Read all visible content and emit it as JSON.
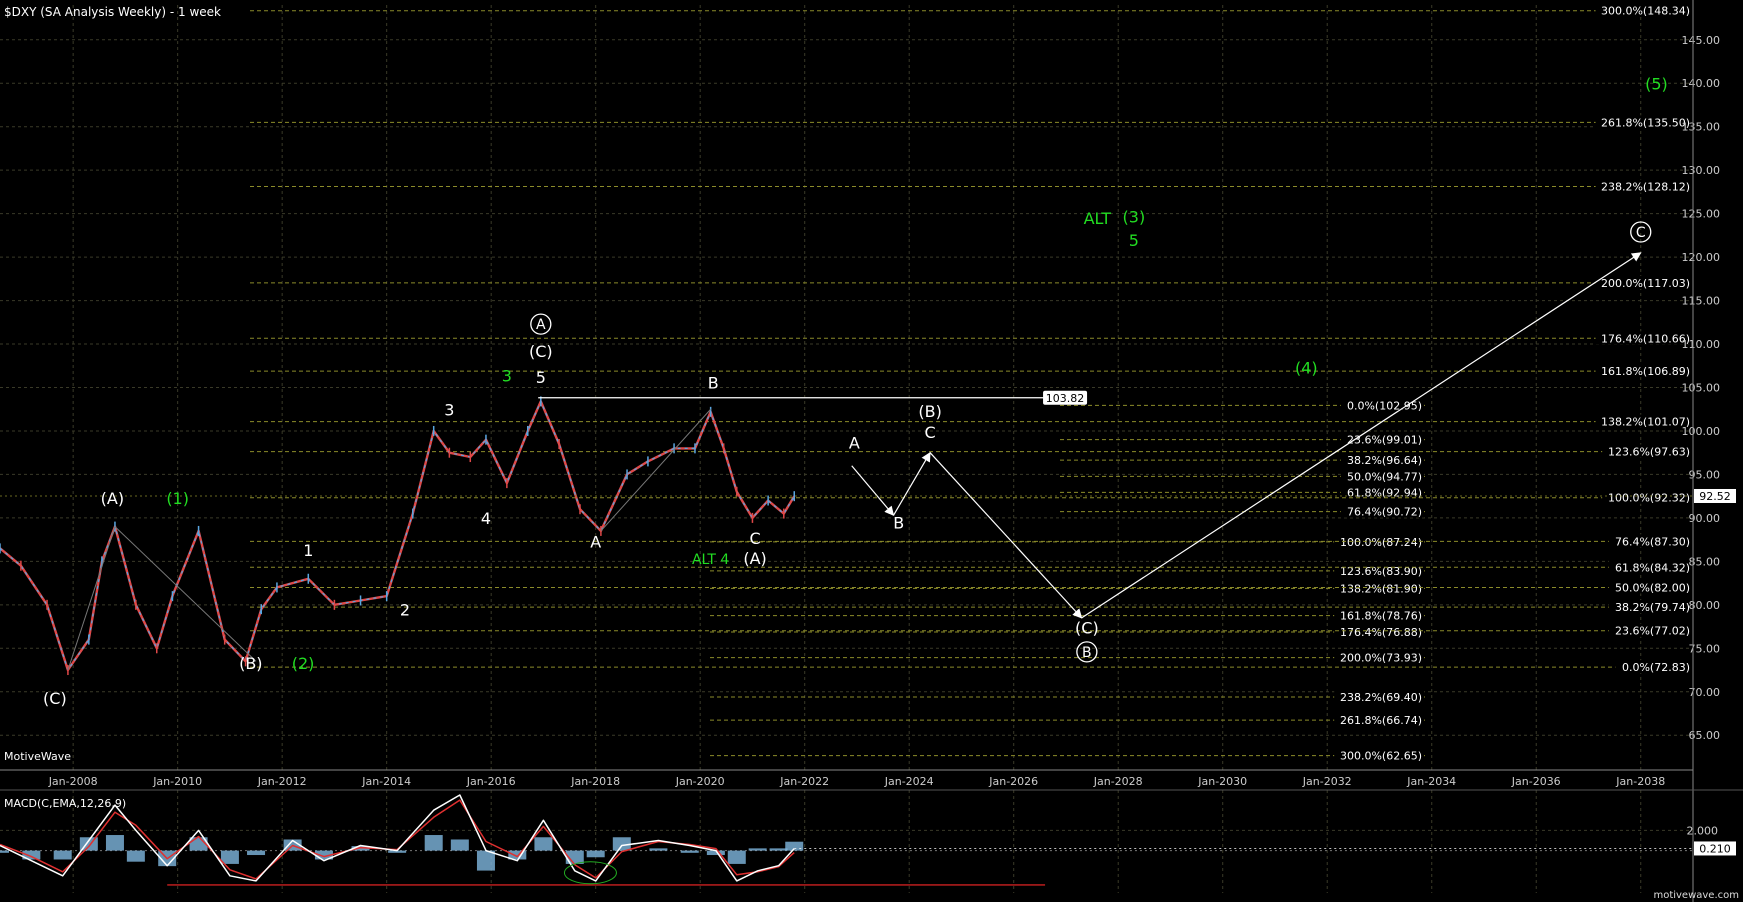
{
  "window": {
    "title": "$DXY (SA Analysis Weekly) - 1 week",
    "brand": "MotiveWave",
    "watermark": "motivewave.com"
  },
  "colors": {
    "background": "#000000",
    "grid": "#3a3a28",
    "fib": "#8b8b2a",
    "fib_label": "#ffffff",
    "price_up": "#5aa6e0",
    "price_down": "#e04848",
    "wave_white": "#ffffff",
    "wave_green": "#22dd22",
    "macd_line": "#ffffff",
    "signal_line": "#e03030",
    "histogram": "#7fb8e0",
    "support_line": "#cc2020"
  },
  "chart_data": [
    {
      "type": "line",
      "title": "$DXY (SA Analysis Weekly) - 1 week",
      "x_tick_labels": [
        "Jan-2008",
        "Jan-2010",
        "Jan-2012",
        "Jan-2014",
        "Jan-2016",
        "Jan-2018",
        "Jan-2020",
        "Jan-2022",
        "Jan-2024",
        "Jan-2026",
        "Jan-2028",
        "Jan-2030",
        "Jan-2032",
        "Jan-2034",
        "Jan-2036",
        "Jan-2038"
      ],
      "y_tick_labels": [
        65,
        70,
        75,
        80,
        85,
        90,
        95,
        100,
        105,
        110,
        115,
        120,
        125,
        130,
        135,
        140,
        145
      ],
      "ylim": [
        61,
        149
      ],
      "xlim": [
        2006.6,
        2039.0
      ],
      "grid": true,
      "last_price": "92.52",
      "series": [
        {
          "x": [
            2006.6,
            2007.0,
            2007.5,
            2007.9,
            2008.3,
            2008.55,
            2008.8,
            2009.2,
            2009.6,
            2009.9,
            2010.4,
            2010.9,
            2011.3,
            2011.6,
            2011.9,
            2012.5,
            2013.0,
            2013.5,
            2014.0,
            2014.5,
            2014.9,
            2015.2,
            2015.6,
            2015.9,
            2016.3,
            2016.7,
            2016.95,
            2017.3,
            2017.7,
            2018.1,
            2018.6,
            2019.0,
            2019.5,
            2019.9,
            2020.2,
            2020.45,
            2020.7,
            2021.0,
            2021.3,
            2021.6,
            2021.8
          ],
          "y": [
            86.5,
            84.5,
            80.0,
            72.5,
            76.0,
            85.0,
            89.0,
            80.0,
            75.0,
            81.0,
            88.5,
            76.0,
            73.5,
            79.5,
            82.0,
            83.0,
            80.0,
            80.5,
            81.0,
            90.5,
            100.0,
            97.5,
            97.0,
            99.0,
            94.0,
            100.0,
            103.4,
            98.5,
            91.0,
            88.5,
            95.0,
            96.5,
            98.0,
            98.0,
            102.2,
            98.0,
            93.0,
            90.0,
            92.0,
            90.5,
            92.5
          ]
        }
      ],
      "annotations": [
        {
          "text": "(A)",
          "x": 2008.75,
          "y": 91.6,
          "color": "white"
        },
        {
          "text": "(1)",
          "x": 2010.0,
          "y": 91.6,
          "color": "green"
        },
        {
          "text": "(C)",
          "x": 2007.65,
          "y": 68.6,
          "color": "white"
        },
        {
          "text": "(B)",
          "x": 2011.4,
          "y": 72.6,
          "color": "white"
        },
        {
          "text": "(2)",
          "x": 2012.4,
          "y": 72.6,
          "color": "green"
        },
        {
          "text": "1",
          "x": 2012.5,
          "y": 85.6,
          "color": "white"
        },
        {
          "text": "2",
          "x": 2014.35,
          "y": 78.8,
          "color": "white"
        },
        {
          "text": "3",
          "x": 2015.2,
          "y": 101.8,
          "color": "white"
        },
        {
          "text": "4",
          "x": 2015.9,
          "y": 89.3,
          "color": "white"
        },
        {
          "text": "3",
          "x": 2016.3,
          "y": 105.7,
          "color": "green"
        },
        {
          "text": "5",
          "x": 2016.95,
          "y": 105.5,
          "color": "white"
        },
        {
          "text": "(C)",
          "x": 2016.95,
          "y": 108.5,
          "color": "white"
        },
        {
          "text": "A",
          "x": 2016.95,
          "y": 111.6,
          "color": "white",
          "circled": true
        },
        {
          "text": "A",
          "x": 2018.0,
          "y": 86.6,
          "color": "white"
        },
        {
          "text": "B",
          "x": 2020.25,
          "y": 104.9,
          "color": "white"
        },
        {
          "text": "C",
          "x": 2021.05,
          "y": 87.0,
          "color": "white"
        },
        {
          "text": "ALT 4",
          "x": 2020.2,
          "y": 84.7,
          "color": "green"
        },
        {
          "text": "(A)",
          "x": 2021.05,
          "y": 84.7,
          "color": "white"
        },
        {
          "text": "A",
          "x": 2022.95,
          "y": 98.0,
          "color": "white"
        },
        {
          "text": "B",
          "x": 2023.8,
          "y": 88.8,
          "color": "white"
        },
        {
          "text": "C",
          "x": 2024.4,
          "y": 99.2,
          "color": "white"
        },
        {
          "text": "(B)",
          "x": 2024.4,
          "y": 101.6,
          "color": "white"
        },
        {
          "text": "(C)",
          "x": 2027.4,
          "y": 76.7,
          "color": "white"
        },
        {
          "text": "B",
          "x": 2027.4,
          "y": 73.9,
          "color": "white",
          "circled": true
        },
        {
          "text": "ALT",
          "x": 2027.6,
          "y": 123.8,
          "color": "green"
        },
        {
          "text": "(3)",
          "x": 2028.3,
          "y": 124.0,
          "color": "green"
        },
        {
          "text": "5",
          "x": 2028.3,
          "y": 121.3,
          "color": "green"
        },
        {
          "text": "(4)",
          "x": 2031.6,
          "y": 106.6,
          "color": "green"
        },
        {
          "text": "(5)",
          "x": 2038.3,
          "y": 139.3,
          "color": "green"
        },
        {
          "text": "C",
          "x": 2038.0,
          "y": 122.2,
          "color": "white",
          "circled": true
        }
      ],
      "projection_path": [
        [
          2022.9,
          96.0
        ],
        [
          2023.7,
          90.3
        ],
        [
          2024.4,
          97.5
        ],
        [
          2027.3,
          78.5
        ],
        [
          2038.0,
          120.5
        ]
      ],
      "horizontal_line": {
        "x1": 2016.9,
        "x2": 2026.6,
        "y": 103.82,
        "label": "103.82"
      },
      "fib_levels_left": [
        {
          "label": "0.0%(102.95)",
          "y": 102.95
        },
        {
          "label": "23.6%(99.01)",
          "y": 99.01
        },
        {
          "label": "38.2%(96.64)",
          "y": 96.64
        },
        {
          "label": "50.0%(94.77)",
          "y": 94.77
        },
        {
          "label": "61.8%(92.94)",
          "y": 92.94
        },
        {
          "label": "76.4%(90.72)",
          "y": 90.72
        }
      ],
      "fib_levels_mid": [
        {
          "label": "100.0%(87.24)",
          "y": 87.24
        },
        {
          "label": "123.6%(83.90)",
          "y": 83.9
        },
        {
          "label": "138.2%(81.90)",
          "y": 81.9
        },
        {
          "label": "161.8%(78.76)",
          "y": 78.76
        },
        {
          "label": "176.4%(76.88)",
          "y": 76.88
        },
        {
          "label": "200.0%(73.93)",
          "y": 73.93
        },
        {
          "label": "238.2%(69.40)",
          "y": 69.4
        },
        {
          "label": "261.8%(66.74)",
          "y": 66.74
        },
        {
          "label": "300.0%(62.65)",
          "y": 62.65
        }
      ],
      "fib_levels_right": [
        {
          "label": "300.0%(148.34)",
          "y": 148.34
        },
        {
          "label": "261.8%(135.50)",
          "y": 135.5
        },
        {
          "label": "238.2%(128.12)",
          "y": 128.12
        },
        {
          "label": "200.0%(117.03)",
          "y": 117.03
        },
        {
          "label": "176.4%(110.66)",
          "y": 110.66
        },
        {
          "label": "161.8%(106.89)",
          "y": 106.89
        },
        {
          "label": "138.2%(101.07)",
          "y": 101.07
        },
        {
          "label": "123.6%(97.63)",
          "y": 97.63
        },
        {
          "label": "100.0%(92.32)",
          "y": 92.32
        },
        {
          "label": "76.4%(87.30)",
          "y": 87.3
        },
        {
          "label": "61.8%(84.32)",
          "y": 84.32
        },
        {
          "label": "50.0%(82.00)",
          "y": 82.0
        },
        {
          "label": "38.2%(79.74)",
          "y": 79.74
        },
        {
          "label": "23.6%(77.02)",
          "y": 77.02
        },
        {
          "label": "0.0%(72.83)",
          "y": 72.83
        }
      ]
    },
    {
      "type": "line",
      "title": "MACD(C,EMA,12,26,9)",
      "y_tick_labels": [
        "2.000"
      ],
      "ylim": [
        -4.2,
        6.0
      ],
      "current_value": "0.210",
      "series": [
        {
          "name": "MACD",
          "x": [
            2006.6,
            2007.2,
            2007.8,
            2008.3,
            2008.8,
            2009.2,
            2009.8,
            2010.4,
            2011.0,
            2011.5,
            2012.2,
            2012.8,
            2013.5,
            2014.2,
            2014.9,
            2015.4,
            2015.9,
            2016.5,
            2017.0,
            2017.6,
            2018.0,
            2018.5,
            2019.2,
            2019.8,
            2020.3,
            2020.7,
            2021.1,
            2021.5,
            2021.8
          ],
          "y": [
            0.5,
            -1.0,
            -2.5,
            1.0,
            4.5,
            2.0,
            -1.5,
            2.0,
            -2.5,
            -3.0,
            1.0,
            -1.0,
            0.5,
            0.0,
            4.0,
            5.5,
            0.0,
            -1.0,
            3.0,
            -2.0,
            -3.0,
            0.5,
            1.0,
            0.5,
            0.0,
            -3.0,
            -2.0,
            -1.5,
            0.2
          ]
        },
        {
          "name": "Signal",
          "x": [
            2006.6,
            2007.2,
            2007.8,
            2008.3,
            2008.8,
            2009.2,
            2009.8,
            2010.4,
            2011.0,
            2011.5,
            2012.2,
            2012.8,
            2013.5,
            2014.2,
            2014.9,
            2015.4,
            2015.9,
            2016.5,
            2017.0,
            2017.6,
            2018.0,
            2018.5,
            2019.2,
            2019.8,
            2020.3,
            2020.7,
            2021.1,
            2021.5,
            2021.8
          ],
          "y": [
            0.6,
            -0.6,
            -2.1,
            0.4,
            3.8,
            2.5,
            -0.8,
            1.4,
            -1.9,
            -2.8,
            0.5,
            -0.6,
            0.3,
            0.1,
            3.3,
            5.0,
            0.9,
            -0.6,
            2.4,
            -1.4,
            -2.7,
            -0.1,
            0.9,
            0.6,
            0.2,
            -2.4,
            -2.1,
            -1.6,
            -0.2
          ]
        }
      ]
    }
  ]
}
